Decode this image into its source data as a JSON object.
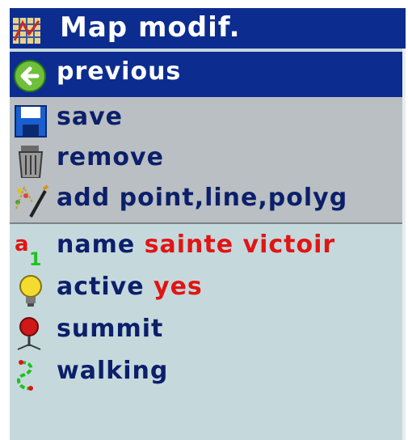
{
  "title": "Map modif.",
  "actions": [
    {
      "label": "previous",
      "icon": "back-arrow-icon",
      "selected": true
    },
    {
      "label": "save",
      "icon": "floppy-disk-icon"
    },
    {
      "label": "remove",
      "icon": "trash-can-icon"
    },
    {
      "label": "add point,line,polyg",
      "icon": "draw-shapes-icon"
    }
  ],
  "properties": [
    {
      "label": "name",
      "value": "sainte victoir",
      "icon": "text-label-icon"
    },
    {
      "label": "active",
      "value": "yes",
      "icon": "light-bulb-icon"
    },
    {
      "label": "summit",
      "value": "",
      "icon": "map-pin-icon"
    },
    {
      "label": "walking",
      "value": "",
      "icon": "walking-path-icon"
    }
  ],
  "colors": {
    "title_bg": "#0c2d8f",
    "selected_bg": "#0c2d8f",
    "action_bg": "#b9bfc2",
    "list_bg": "#c5d9dc",
    "label_color": "#0c1f6a",
    "value_color": "#e01515"
  }
}
